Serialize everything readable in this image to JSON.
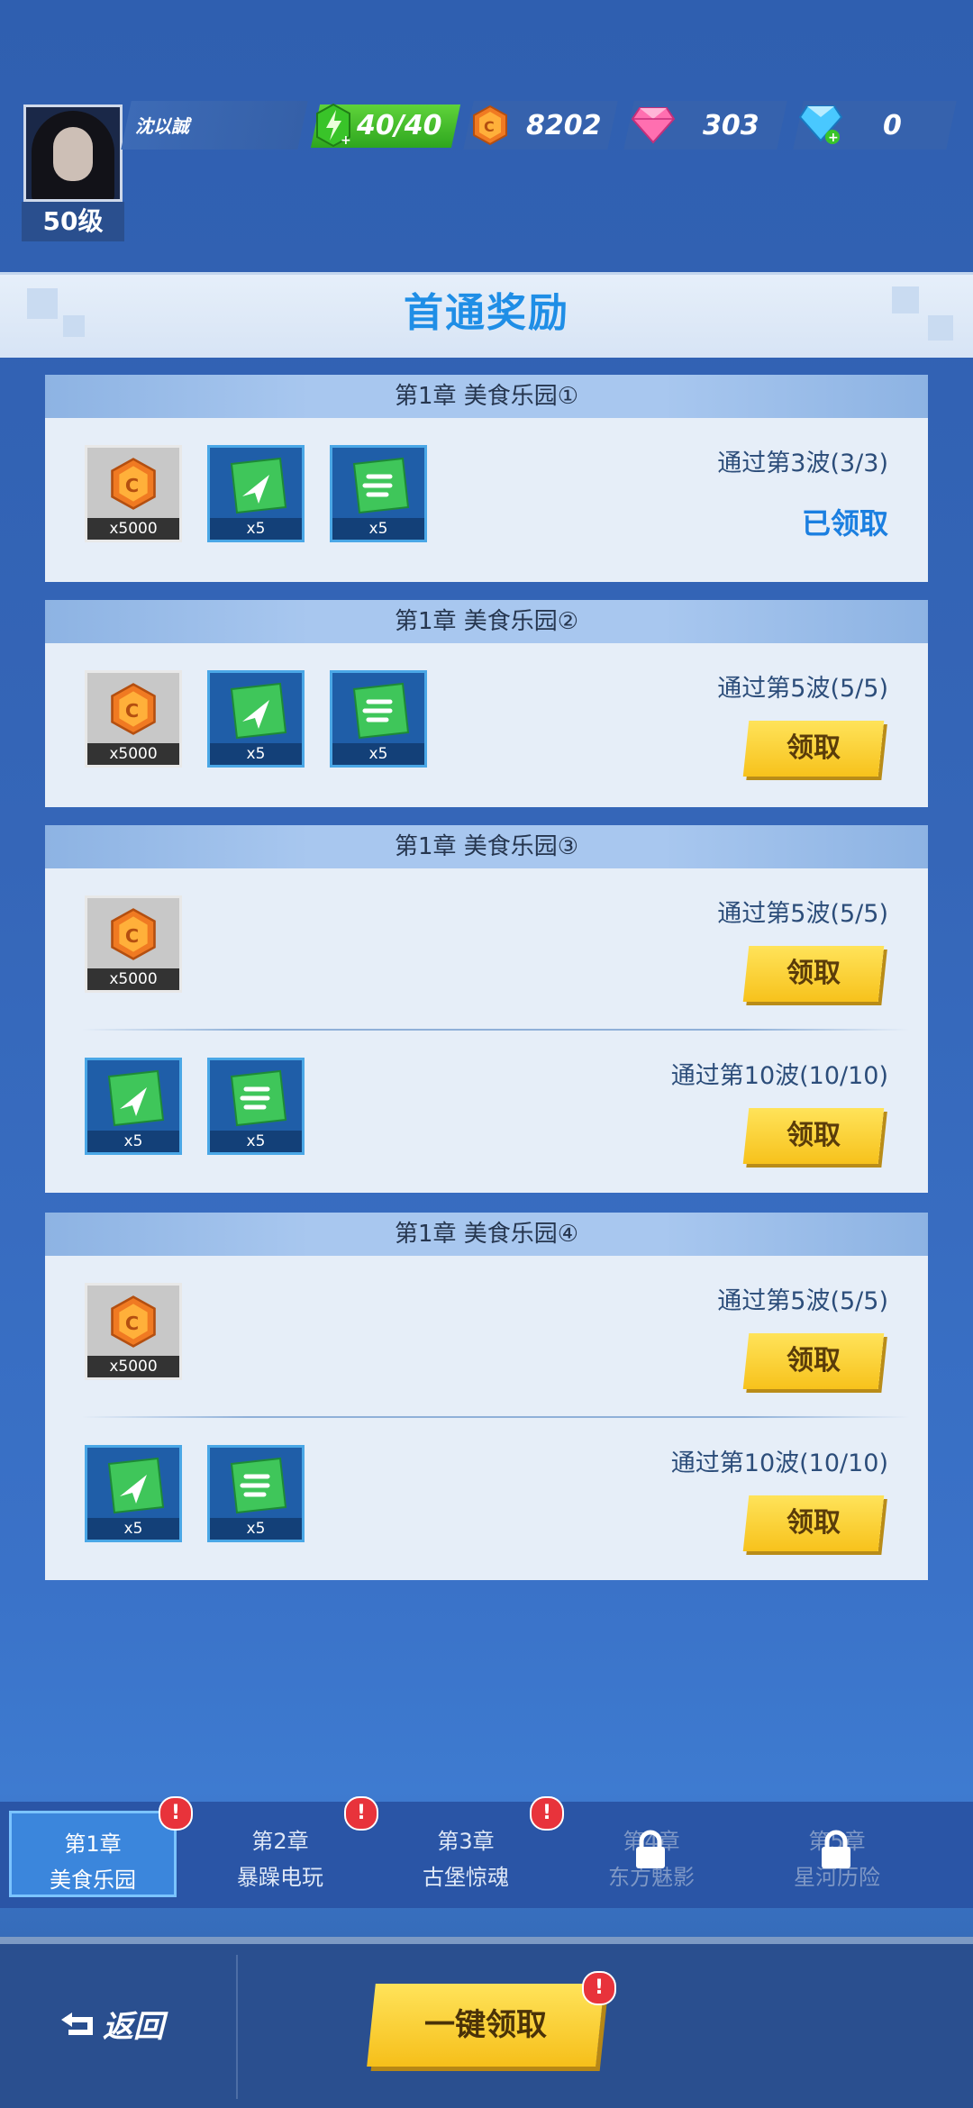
{
  "player": {
    "name": "沈以誠",
    "level": "50级"
  },
  "resources": {
    "energy": "40/40",
    "coins": "8202",
    "gems": "303",
    "diamonds": "0"
  },
  "title": "首通奖励",
  "cards": [
    {
      "header": "第1章  美食乐园①",
      "rows": [
        {
          "condition": "通过第3波(3/3)",
          "status": "已领取",
          "items": [
            "x5000",
            "x5",
            "x5"
          ]
        }
      ]
    },
    {
      "header": "第1章  美食乐园②",
      "rows": [
        {
          "condition": "通过第5波(5/5)",
          "button": "领取",
          "items": [
            "x5000",
            "x5",
            "x5"
          ]
        }
      ]
    },
    {
      "header": "第1章  美食乐园③",
      "rows": [
        {
          "condition": "通过第5波(5/5)",
          "button": "领取",
          "items": [
            "x5000"
          ]
        },
        {
          "condition": "通过第10波(10/10)",
          "button": "领取",
          "items": [
            "x5",
            "x5"
          ]
        }
      ]
    },
    {
      "header": "第1章  美食乐园④",
      "rows": [
        {
          "condition": "通过第5波(5/5)",
          "button": "领取",
          "items": [
            "x5000"
          ]
        },
        {
          "condition": "通过第10波(10/10)",
          "button": "领取",
          "items": [
            "x5",
            "x5"
          ]
        }
      ]
    }
  ],
  "tabs": [
    {
      "chapter": "第1章",
      "name": "美食乐园",
      "alert": "!"
    },
    {
      "chapter": "第2章",
      "name": "暴躁电玩",
      "alert": "!"
    },
    {
      "chapter": "第3章",
      "name": "古堡惊魂",
      "alert": "!"
    },
    {
      "chapter": "第4章",
      "name": "东方魅影"
    },
    {
      "chapter": "第5章",
      "name": "星河历险"
    }
  ],
  "bottom": {
    "back": "返回",
    "claim_all": "一键领取",
    "claim_all_alert": "!"
  }
}
